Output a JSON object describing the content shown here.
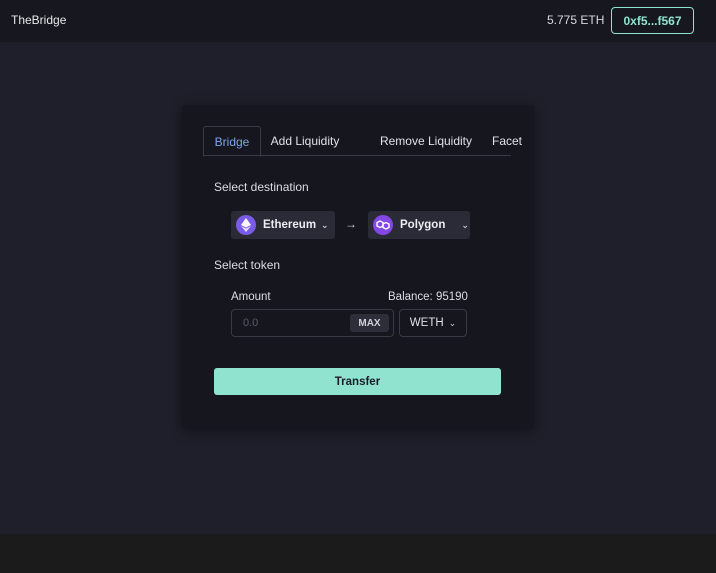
{
  "header": {
    "brand": "TheBridge",
    "eth_balance": "5.775 ETH",
    "wallet_address": "0xf5...f567"
  },
  "tabs": [
    {
      "label": "Bridge",
      "active": true
    },
    {
      "label": "Add Liquidity",
      "active": false
    },
    {
      "label": "Remove Liquidity",
      "active": false
    },
    {
      "label": "Facet",
      "active": false
    }
  ],
  "destination": {
    "label": "Select destination",
    "from_chain": "Ethereum",
    "to_chain": "Polygon",
    "arrow": "→"
  },
  "token": {
    "label": "Select token",
    "amount_label": "Amount",
    "balance_label": "Balance: 95190",
    "amount_placeholder": "0.0",
    "max_label": "MAX",
    "selected_token": "WETH"
  },
  "transfer_label": "Transfer",
  "icons": {
    "ethereum": "ethereum-logo-icon",
    "polygon": "polygon-logo-icon",
    "chevron": "chevron-down-icon"
  },
  "colors": {
    "accent": "#8fe3cf",
    "active_tab": "#7fa4ef",
    "ethereum_icon": "#7b5ce8",
    "polygon_icon": "#8247e5"
  }
}
